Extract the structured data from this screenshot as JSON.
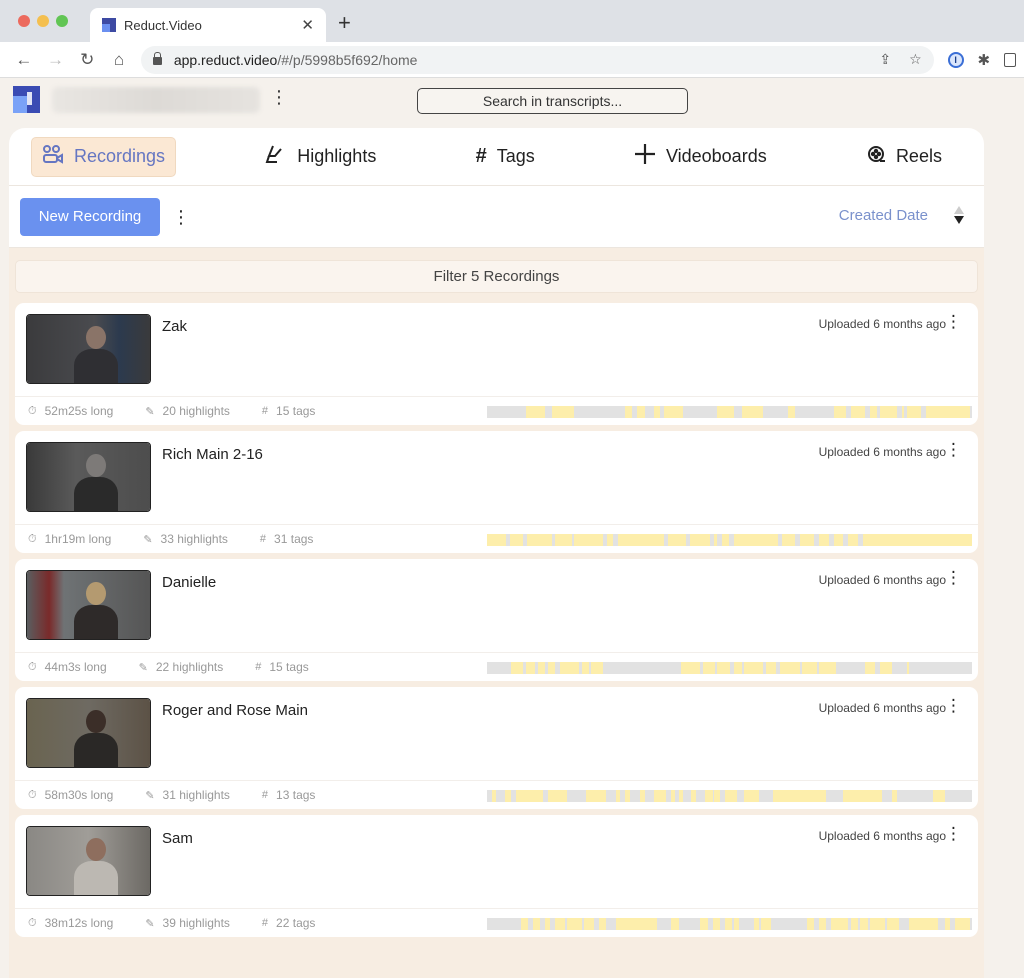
{
  "browser": {
    "tab_title": "Reduct.Video",
    "url_host": "app.reduct.video",
    "url_path": "/#/p/5998b5f692/home"
  },
  "header": {
    "search_placeholder": "Search in transcripts..."
  },
  "nav": {
    "items": [
      {
        "label": "Recordings",
        "icon": "recordings-icon",
        "active": true
      },
      {
        "label": "Highlights",
        "icon": "highlighter-icon",
        "active": false
      },
      {
        "label": "Tags",
        "icon": "hash-icon",
        "active": false
      },
      {
        "label": "Videoboards",
        "icon": "plus-icon",
        "active": false
      },
      {
        "label": "Reels",
        "icon": "reel-icon",
        "active": false
      }
    ]
  },
  "actions": {
    "new_recording_label": "New Recording",
    "sort_label": "Created Date",
    "sort_direction": "descending"
  },
  "filter": {
    "label": "Filter 5 Recordings"
  },
  "colors": {
    "accent": "#6a91ef",
    "active_nav_bg": "#fbe8d4",
    "active_nav_text": "#6576c2",
    "highlight_segment": "#fdeeab",
    "timeline_bg": "#e2e2e2",
    "panel_bg": "#f7ede2"
  },
  "recordings": [
    {
      "title": "Zak",
      "uploaded": "Uploaded 6 months ago",
      "duration": "52m25s long",
      "highlights": "20 highlights",
      "tags": "15 tags",
      "segments": [
        [
          8,
          12
        ],
        [
          13.5,
          18
        ],
        [
          28.5,
          29.8
        ],
        [
          31,
          32.5
        ],
        [
          34.5,
          35.7
        ],
        [
          36.5,
          40.5
        ],
        [
          47.5,
          51
        ],
        [
          52.5,
          57
        ],
        [
          62,
          63.5
        ],
        [
          71.5,
          74
        ],
        [
          75,
          78
        ],
        [
          79,
          80.5
        ],
        [
          81,
          84.5
        ],
        [
          85.5,
          86
        ],
        [
          86.5,
          89.5
        ],
        [
          90.5,
          99.5
        ]
      ]
    },
    {
      "title": "Rich Main 2-16",
      "uploaded": "Uploaded 6 months ago",
      "duration": "1hr19m long",
      "highlights": "33 highlights",
      "tags": "31 tags",
      "segments": [
        [
          0,
          4
        ],
        [
          4.8,
          7.5
        ],
        [
          8.2,
          13.5
        ],
        [
          14,
          17.5
        ],
        [
          18,
          24
        ],
        [
          24.8,
          26
        ],
        [
          27,
          36.5
        ],
        [
          37.3,
          41
        ],
        [
          41.8,
          46
        ],
        [
          46.8,
          47.5
        ],
        [
          48.5,
          50
        ],
        [
          51,
          60
        ],
        [
          60.8,
          63.5
        ],
        [
          64.5,
          67.5
        ],
        [
          68.5,
          70.5
        ],
        [
          71.5,
          73.5
        ],
        [
          74.5,
          76.5
        ],
        [
          77.5,
          100
        ]
      ]
    },
    {
      "title": "Danielle",
      "uploaded": "Uploaded 6 months ago",
      "duration": "44m3s long",
      "highlights": "22 highlights",
      "tags": "15 tags",
      "segments": [
        [
          5,
          7.5
        ],
        [
          8,
          10
        ],
        [
          10.5,
          12
        ],
        [
          12.5,
          14
        ],
        [
          15,
          19
        ],
        [
          19.5,
          21
        ],
        [
          21.5,
          24
        ],
        [
          40,
          44
        ],
        [
          44.5,
          47
        ],
        [
          47.5,
          50
        ],
        [
          51,
          52.5
        ],
        [
          53,
          57
        ],
        [
          57.5,
          59.5
        ],
        [
          60.5,
          64.5
        ],
        [
          65,
          68
        ],
        [
          68.5,
          72
        ],
        [
          78,
          80
        ],
        [
          81,
          83.5
        ],
        [
          86.5,
          87
        ]
      ]
    },
    {
      "title": "Roger and Rose Main",
      "uploaded": "Uploaded 6 months ago",
      "duration": "58m30s long",
      "highlights": "31 highlights",
      "tags": "13 tags",
      "segments": [
        [
          1,
          1.8
        ],
        [
          3.8,
          5
        ],
        [
          6,
          11.5
        ],
        [
          12.5,
          16.5
        ],
        [
          20.5,
          24.5
        ],
        [
          26.5,
          27.5
        ],
        [
          28.5,
          29.5
        ],
        [
          31.5,
          32.5
        ],
        [
          34.5,
          37
        ],
        [
          38,
          38.8
        ],
        [
          39.5,
          40.5
        ],
        [
          42,
          43
        ],
        [
          45,
          46.5
        ],
        [
          46.8,
          48
        ],
        [
          49,
          51.5
        ],
        [
          53,
          56
        ],
        [
          59,
          70
        ],
        [
          73.5,
          81.5
        ],
        [
          83.5,
          84.5
        ],
        [
          92,
          94.5
        ]
      ]
    },
    {
      "title": "Sam",
      "uploaded": "Uploaded 6 months ago",
      "duration": "38m12s long",
      "highlights": "39 highlights",
      "tags": "22 tags",
      "segments": [
        [
          7,
          8.5
        ],
        [
          9.5,
          11
        ],
        [
          12,
          13
        ],
        [
          14,
          16
        ],
        [
          16.5,
          19.5
        ],
        [
          20,
          22
        ],
        [
          23,
          24.5
        ],
        [
          26.5,
          35
        ],
        [
          38,
          39.5
        ],
        [
          44,
          45.5
        ],
        [
          46.5,
          48
        ],
        [
          49,
          50.5
        ],
        [
          51,
          52
        ],
        [
          55,
          56
        ],
        [
          56.5,
          58.5
        ],
        [
          66,
          67.5
        ],
        [
          68.5,
          70
        ],
        [
          71,
          74.5
        ],
        [
          75,
          76.5
        ],
        [
          77,
          78.5
        ],
        [
          79,
          82
        ],
        [
          82.5,
          85
        ],
        [
          87,
          93
        ],
        [
          94.5,
          95.5
        ],
        [
          96.5,
          99.5
        ]
      ]
    }
  ]
}
